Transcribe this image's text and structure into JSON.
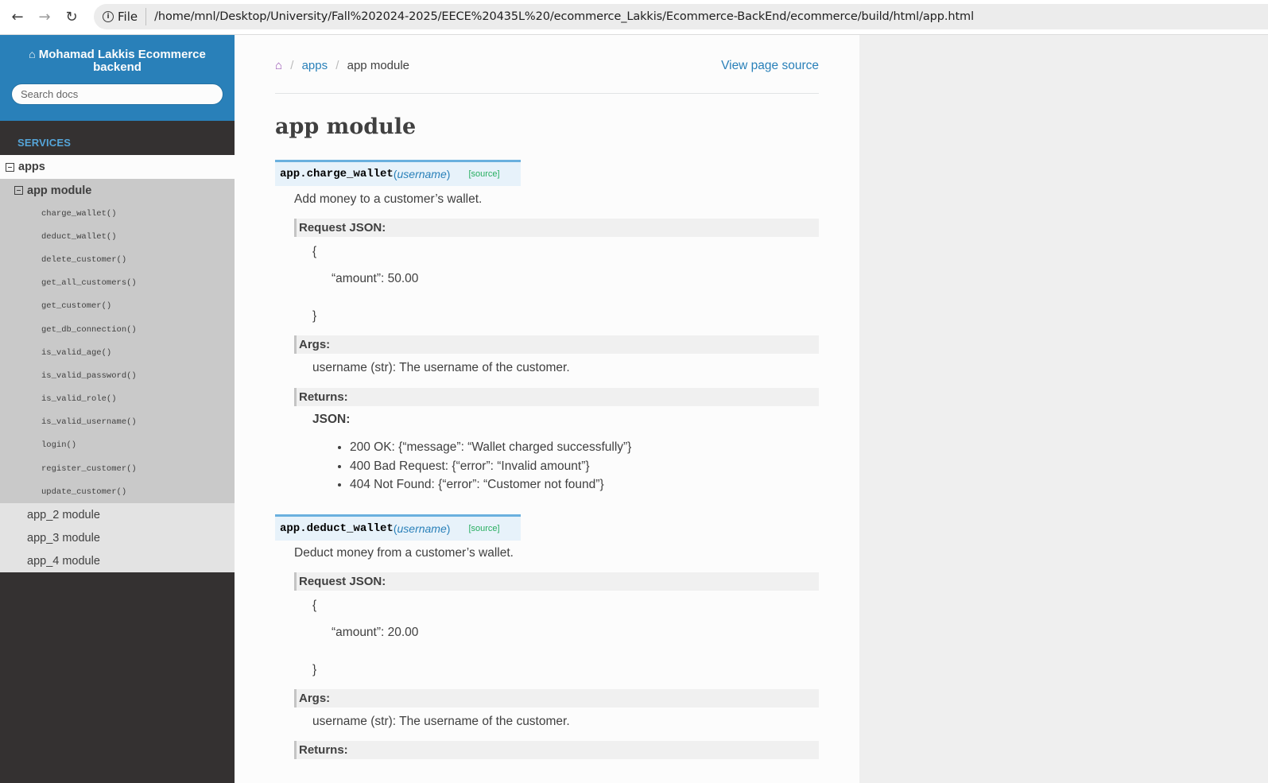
{
  "browser": {
    "back_icon": "←",
    "forward_icon": "→",
    "reload_icon": "↻",
    "file_label": "File",
    "url": "/home/mnl/Desktop/University/Fall%202024-2025/EECE%20435L%20/ecommerce_Lakkis/Ecommerce-BackEnd/ecommerce/build/html/app.html"
  },
  "sidebar": {
    "project_name": "Mohamad Lakkis Ecommerce backend",
    "search_placeholder": "Search docs",
    "caption": "Services",
    "l1_label": "apps",
    "l2_label": "app module",
    "functions": [
      "charge_wallet()",
      "deduct_wallet()",
      "delete_customer()",
      "get_all_customers()",
      "get_customer()",
      "get_db_connection()",
      "is_valid_age()",
      "is_valid_password()",
      "is_valid_role()",
      "is_valid_username()",
      "login()",
      "register_customer()",
      "update_customer()"
    ],
    "other_modules": [
      "app_2 module",
      "app_3 module",
      "app_4 module"
    ]
  },
  "breadcrumb": {
    "home_icon": "home-icon",
    "apps": "apps",
    "current": "app module",
    "sep": "/",
    "view_source": "View page source"
  },
  "page": {
    "title": "app module"
  },
  "functions": [
    {
      "name": "app.charge_wallet",
      "open_paren": "(",
      "param": "username",
      "close_paren": ")",
      "source": "[source]",
      "description": "Add money to a customer’s wallet.",
      "request_label": "Request JSON:",
      "brace_open": "{",
      "json_body": "“amount”: 50.00",
      "brace_close": "}",
      "args_label": "Args:",
      "args_text": "username (str): The username of the customer.",
      "returns_label": "Returns:",
      "returns_json_label": "JSON:",
      "returns": [
        "200 OK: {“message”: “Wallet charged successfully”}",
        "400 Bad Request: {“error”: “Invalid amount”}",
        "404 Not Found: {“error”: “Customer not found”}"
      ]
    },
    {
      "name": "app.deduct_wallet",
      "open_paren": "(",
      "param": "username",
      "close_paren": ")",
      "source": "[source]",
      "description": "Deduct money from a customer’s wallet.",
      "request_label": "Request JSON:",
      "brace_open": "{",
      "json_body": "“amount”: 20.00",
      "brace_close": "}",
      "args_label": "Args:",
      "args_text": "username (str): The username of the customer.",
      "returns_label": "Returns:"
    }
  ],
  "colors": {
    "sidebar_top": "#2980b9",
    "sidebar_bg": "#343131",
    "link": "#2980b9",
    "home_icon": "#9b59b6",
    "source_link": "#27ae60",
    "sig_bg": "#e7f2fa",
    "sig_border": "#6ab0de"
  }
}
